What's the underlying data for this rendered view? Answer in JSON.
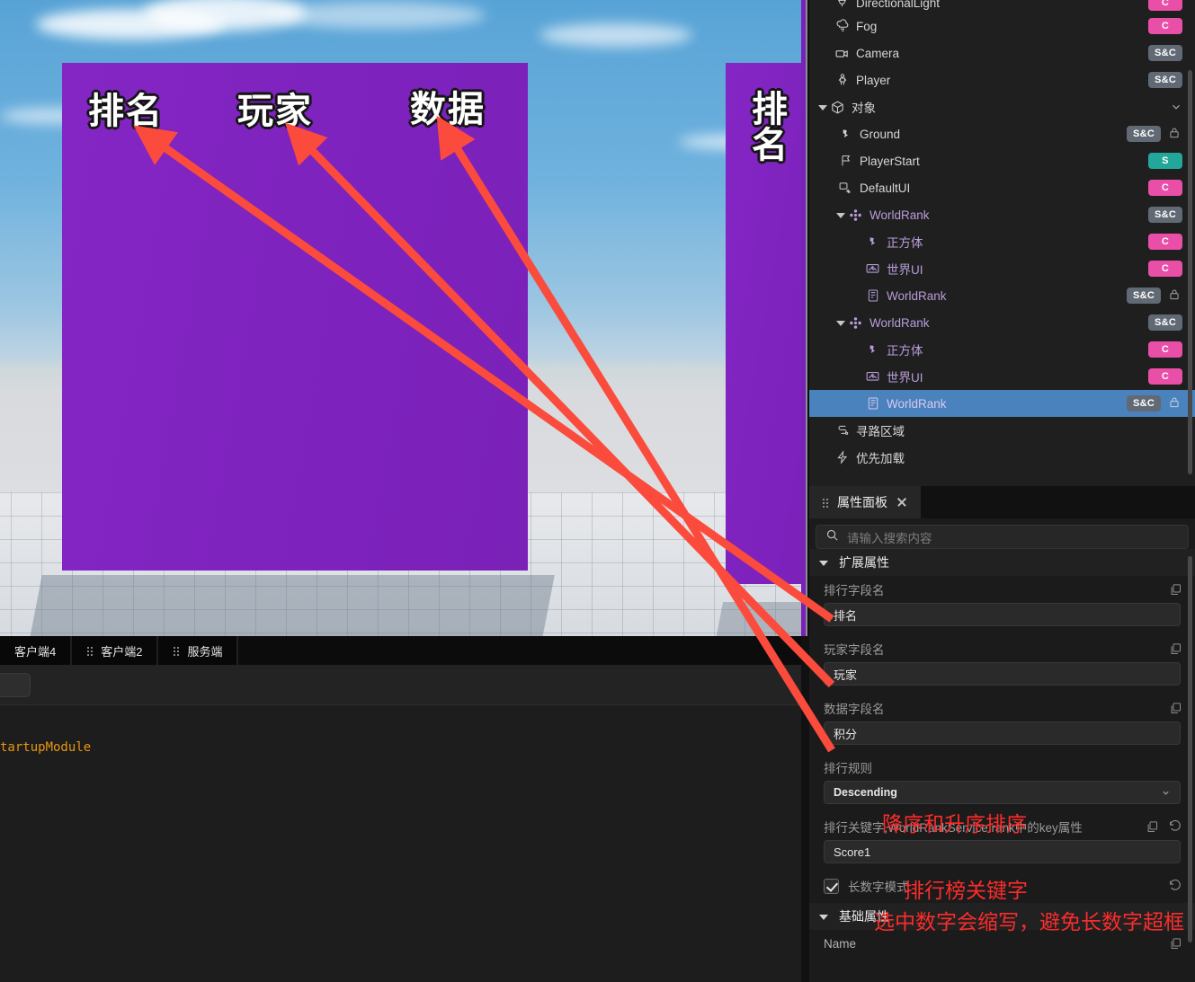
{
  "viewport": {
    "billboard_labels": [
      "排名",
      "玩家",
      "数据"
    ],
    "billboard2_label": "排名",
    "client_tabs": [
      {
        "label": "客户端4",
        "grip": false
      },
      {
        "label": "客户端2",
        "grip": true
      },
      {
        "label": "服务端",
        "grip": true
      }
    ],
    "log_line": "tartupModule"
  },
  "hierarchy": {
    "rows": [
      {
        "label": "DirectionalLight",
        "icon": "directional-light-icon",
        "badge": "C",
        "badge_kind": "c",
        "depth": 1,
        "caret": false,
        "lock": false,
        "purple": false,
        "selected": false,
        "clipped": true
      },
      {
        "label": "Fog",
        "icon": "fog-icon",
        "badge": "C",
        "badge_kind": "c",
        "depth": 1,
        "caret": false,
        "lock": false,
        "purple": false,
        "selected": false
      },
      {
        "label": "Camera",
        "icon": "camera-icon",
        "badge": "S&C",
        "badge_kind": "sc",
        "depth": 1,
        "caret": false,
        "lock": false,
        "purple": false,
        "selected": false
      },
      {
        "label": "Player",
        "icon": "player-icon",
        "badge": "S&C",
        "badge_kind": "sc",
        "depth": 1,
        "caret": false,
        "lock": false,
        "purple": false,
        "selected": false
      },
      {
        "label": "对象",
        "icon": "cube-icon",
        "badge": "",
        "badge_kind": "",
        "depth": 0,
        "caret": true,
        "lock": false,
        "purple": false,
        "selected": false,
        "chevron": true
      },
      {
        "label": "Ground",
        "icon": "mesh-icon",
        "badge": "S&C",
        "badge_kind": "sc",
        "depth": 1,
        "caret": false,
        "lock": true,
        "purple": false,
        "selected": false
      },
      {
        "label": "PlayerStart",
        "icon": "flag-icon",
        "badge": "S",
        "badge_kind": "s",
        "depth": 1,
        "caret": false,
        "lock": false,
        "purple": false,
        "selected": false
      },
      {
        "label": "DefaultUI",
        "icon": "ui-icon",
        "badge": "C",
        "badge_kind": "c",
        "depth": 1,
        "caret": false,
        "lock": false,
        "purple": false,
        "selected": false
      },
      {
        "label": "WorldRank",
        "icon": "prefab-icon",
        "badge": "S&C",
        "badge_kind": "sc",
        "depth": 1,
        "caret": true,
        "lock": false,
        "purple": true,
        "selected": false
      },
      {
        "label": "正方体",
        "icon": "mesh-icon",
        "badge": "C",
        "badge_kind": "c",
        "depth": 2,
        "caret": false,
        "lock": false,
        "purple": true,
        "selected": false
      },
      {
        "label": "世界UI",
        "icon": "worldui-icon",
        "badge": "C",
        "badge_kind": "c",
        "depth": 2,
        "caret": false,
        "lock": false,
        "purple": true,
        "selected": false
      },
      {
        "label": "WorldRank",
        "icon": "script-icon",
        "badge": "S&C",
        "badge_kind": "sc",
        "depth": 2,
        "caret": false,
        "lock": true,
        "purple": true,
        "selected": false
      },
      {
        "label": "WorldRank",
        "icon": "prefab-icon",
        "badge": "S&C",
        "badge_kind": "sc",
        "depth": 1,
        "caret": true,
        "lock": false,
        "purple": true,
        "selected": false
      },
      {
        "label": "正方体",
        "icon": "mesh-icon",
        "badge": "C",
        "badge_kind": "c",
        "depth": 2,
        "caret": false,
        "lock": false,
        "purple": true,
        "selected": false
      },
      {
        "label": "世界UI",
        "icon": "worldui-icon",
        "badge": "C",
        "badge_kind": "c",
        "depth": 2,
        "caret": false,
        "lock": false,
        "purple": true,
        "selected": false
      },
      {
        "label": "WorldRank",
        "icon": "script-icon",
        "badge": "S&C",
        "badge_kind": "sc",
        "depth": 2,
        "caret": false,
        "lock": true,
        "purple": true,
        "selected": true
      },
      {
        "label": "寻路区域",
        "icon": "navmesh-icon",
        "badge": "",
        "badge_kind": "",
        "depth": 0,
        "caret": false,
        "lock": false,
        "purple": false,
        "selected": false
      },
      {
        "label": "优先加载",
        "icon": "preload-icon",
        "badge": "",
        "badge_kind": "",
        "depth": 0,
        "caret": false,
        "lock": false,
        "purple": false,
        "selected": false
      }
    ]
  },
  "properties": {
    "tab_title": "属性面板",
    "search_placeholder": "请输入搜索内容",
    "section_extended": "扩展属性",
    "section_basic": "基础属性",
    "fields": [
      {
        "label": "排行字段名",
        "value": "排名"
      },
      {
        "label": "玩家字段名",
        "value": "玩家"
      },
      {
        "label": "数据字段名",
        "value": "积分"
      }
    ],
    "rule_label": "排行规则",
    "rule_value": "Descending",
    "key_label": "排行关键字,WorldRankService.rank中的key属性",
    "key_value": "Score1",
    "checkbox_label": "长数字模式",
    "checkbox_checked": true,
    "name_label": "Name"
  },
  "annotations": {
    "note_rule": "降序和升序排序",
    "note_key": "排行榜关键字",
    "note_longnum": "选中数字会缩写，避免长数字超框",
    "color": "#fb2c2c"
  },
  "colors": {
    "accent_purple": "#7a21b8",
    "badge_sc": "#616a74",
    "badge_c": "#ea4fa8",
    "badge_s": "#23a79a",
    "selection": "#4a82bd",
    "log_orange": "#e8960f"
  }
}
